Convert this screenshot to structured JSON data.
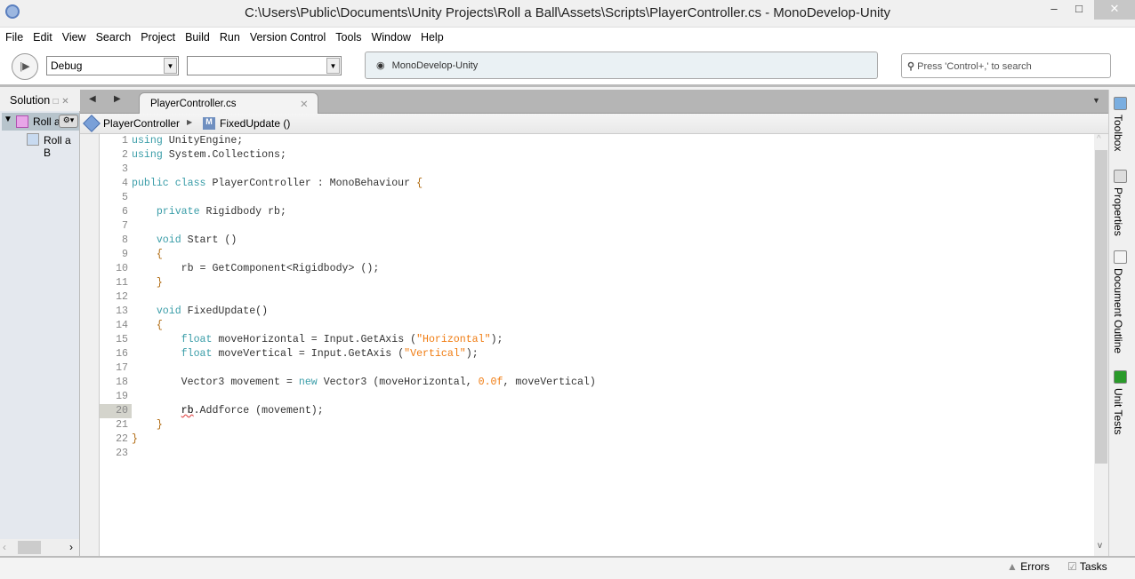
{
  "window": {
    "title": "C:\\Users\\Public\\Documents\\Unity Projects\\Roll a Ball\\Assets\\Scripts\\PlayerController.cs - MonoDevelop-Unity",
    "minimize": "–",
    "maximize": "□",
    "close": "✕"
  },
  "menu": [
    "File",
    "Edit",
    "View",
    "Search",
    "Project",
    "Build",
    "Run",
    "Version Control",
    "Tools",
    "Window",
    "Help"
  ],
  "toolbar": {
    "config": "Debug",
    "target": "",
    "status": "MonoDevelop-Unity",
    "search_placeholder": "Press 'Control+,' to search"
  },
  "solution": {
    "title": "Solution",
    "items": [
      {
        "label": "Roll a"
      },
      {
        "label": "Roll a B"
      }
    ]
  },
  "editor": {
    "tab": "PlayerController.cs",
    "breadcrumb": [
      "PlayerController",
      "FixedUpdate ()"
    ],
    "current_line": 20,
    "lines": [
      [
        [
          "kw",
          "using"
        ],
        [
          "tx",
          " UnityEngine;"
        ]
      ],
      [
        [
          "kw",
          "using"
        ],
        [
          "tx",
          " System.Collections;"
        ]
      ],
      [],
      [
        [
          "kw",
          "public class"
        ],
        [
          "tx",
          " PlayerController : MonoBehaviour "
        ],
        [
          "br",
          "{"
        ]
      ],
      [],
      [
        [
          "tx",
          "    "
        ],
        [
          "kw",
          "private"
        ],
        [
          "tx",
          " Rigidbody rb;"
        ]
      ],
      [],
      [
        [
          "tx",
          "    "
        ],
        [
          "kw",
          "void"
        ],
        [
          "tx",
          " Start ()"
        ]
      ],
      [
        [
          "tx",
          "    "
        ],
        [
          "br",
          "{"
        ]
      ],
      [
        [
          "tx",
          "        rb = GetComponent<Rigidbody> ();"
        ]
      ],
      [
        [
          "tx",
          "    "
        ],
        [
          "br",
          "}"
        ]
      ],
      [],
      [
        [
          "tx",
          "    "
        ],
        [
          "kw",
          "void"
        ],
        [
          "tx",
          " FixedUpdate()"
        ]
      ],
      [
        [
          "tx",
          "    "
        ],
        [
          "br",
          "{"
        ]
      ],
      [
        [
          "tx",
          "        "
        ],
        [
          "kw",
          "float"
        ],
        [
          "tx",
          " moveHorizontal = Input.GetAxis ("
        ],
        [
          "str",
          "\"Horizontal\""
        ],
        [
          "tx",
          ");"
        ]
      ],
      [
        [
          "tx",
          "        "
        ],
        [
          "kw",
          "float"
        ],
        [
          "tx",
          " moveVertical = Input.GetAxis ("
        ],
        [
          "str",
          "\"Vertical\""
        ],
        [
          "tx",
          ");"
        ]
      ],
      [],
      [
        [
          "tx",
          "        Vector3 movement = "
        ],
        [
          "kw",
          "new"
        ],
        [
          "tx",
          " Vector3 (moveHorizontal, "
        ],
        [
          "num",
          "0.0f"
        ],
        [
          "tx",
          ", moveVertical)"
        ]
      ],
      [],
      [
        [
          "tx",
          "        "
        ],
        [
          "squig",
          "rb"
        ],
        [
          "tx",
          ".Addforce (movement);"
        ]
      ],
      [
        [
          "tx",
          "    "
        ],
        [
          "br",
          "}"
        ]
      ],
      [
        [
          "br",
          "}"
        ]
      ],
      []
    ]
  },
  "right_pads": [
    "Toolbox",
    "Properties",
    "Document Outline",
    "Unit Tests"
  ],
  "statusbar": {
    "errors": "Errors",
    "tasks": "Tasks"
  }
}
